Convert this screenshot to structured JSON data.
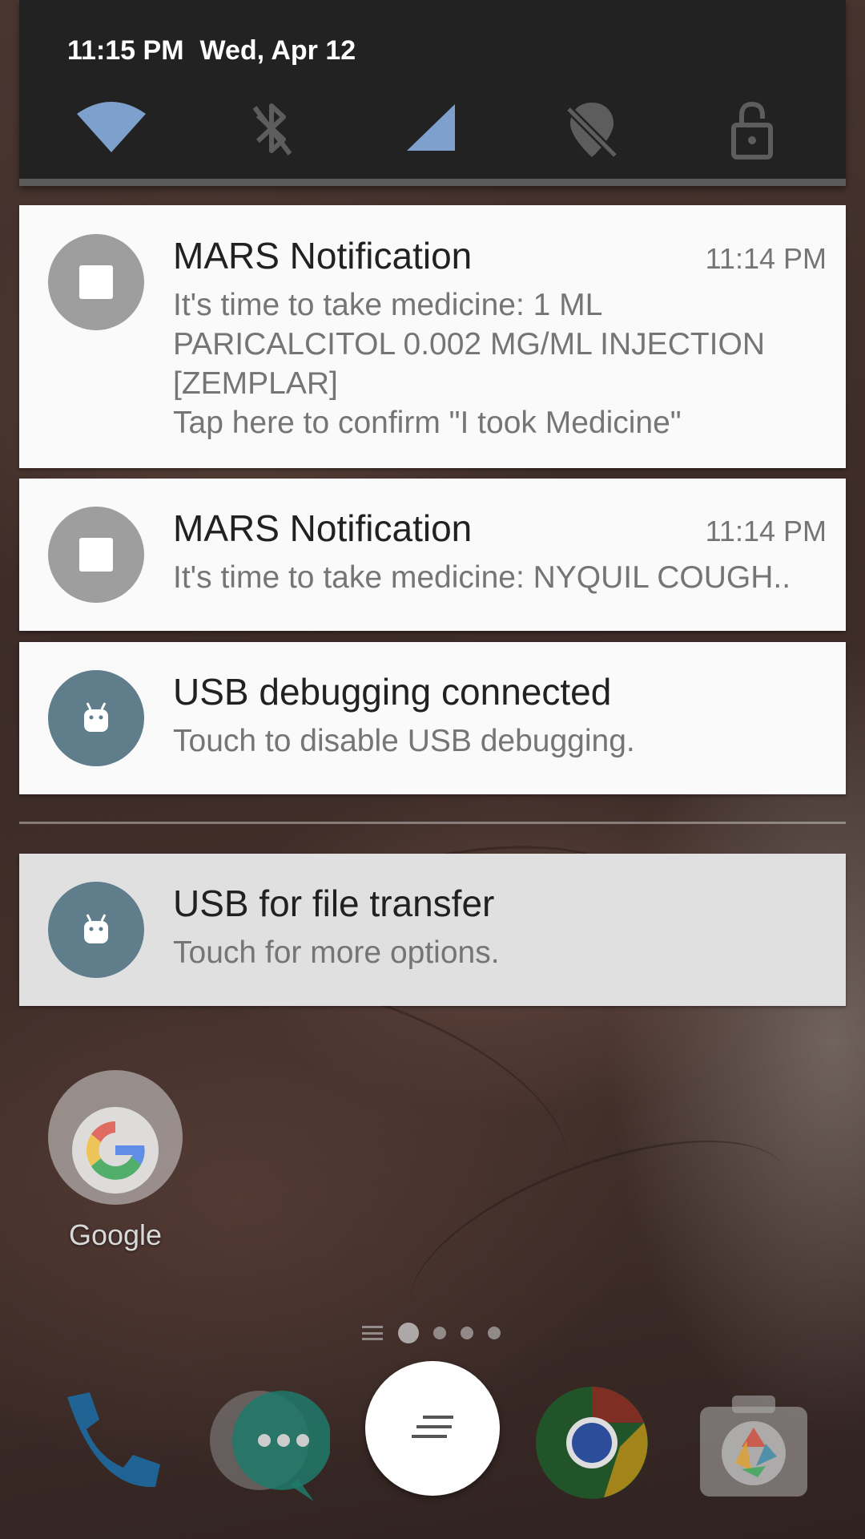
{
  "quick_settings": {
    "time": "11:15 PM",
    "date": "Wed, Apr 12",
    "icons": [
      "wifi-icon",
      "bluetooth-off-icon",
      "cellular-signal-icon",
      "location-off-icon",
      "screen-lock-icon"
    ],
    "accent_color": "#7ea0cc"
  },
  "notifications": [
    {
      "app": "mars",
      "icon": "stop-icon",
      "title": "MARS Notification",
      "time": "11:14 PM",
      "text": "It's time to take medicine: 1 ML PARICALCITOL 0.002 MG/ML INJECTION [ZEMPLAR]",
      "subtext": "Tap here to confirm \"I took Medicine\""
    },
    {
      "app": "mars",
      "icon": "stop-icon",
      "title": "MARS Notification",
      "time": "11:14 PM",
      "text": "It's time to take medicine: NYQUIL COUGH.."
    },
    {
      "app": "android-system",
      "icon": "android-icon",
      "title": "USB debugging connected",
      "text": "Touch to disable USB debugging."
    },
    {
      "app": "android-system",
      "icon": "android-icon",
      "title": "USB for file transfer",
      "text": "Touch for more options."
    }
  ],
  "home": {
    "folder_label": "Google",
    "pages": 4,
    "active_page": 1,
    "dock": [
      "phone-icon",
      "messenger-icon",
      "app-drawer-icon",
      "chrome-icon",
      "camera-icon"
    ]
  }
}
